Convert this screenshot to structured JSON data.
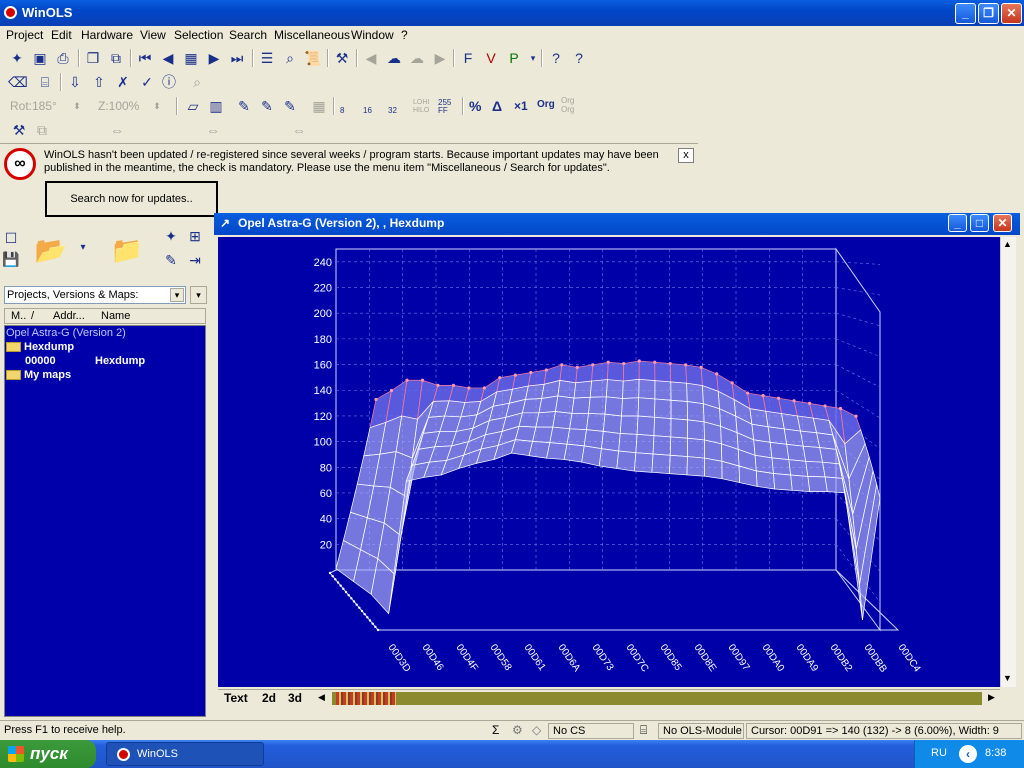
{
  "window": {
    "title": "WinOLS"
  },
  "menu": [
    "Project",
    "Edit",
    "Hardware",
    "View",
    "Selection",
    "Search",
    "Miscellaneous",
    "Window",
    "?"
  ],
  "toolbar": {
    "rot_label": "Rot:185°",
    "zoom_label": "Z:100%",
    "bits": [
      "8",
      "16",
      "32"
    ],
    "lohi_label": "LOHI HILO",
    "base_label": "255 FF",
    "percent_label": "%",
    "delta_label": "Δ",
    "times1_label": "×1",
    "org_label": "Org",
    "org2_label": "Org Org"
  },
  "notice": {
    "text": "WinOLS hasn't been updated / re-registered since several weeks / program starts. Because important updates may have been published in the meantime, the check is mandatory. Please use the menu item \"Miscellaneous / Search for updates\".",
    "button": "Search now for updates..",
    "close": "x"
  },
  "left_panel": {
    "dropdown": "Projects, Versions & Maps:",
    "columns": [
      "M..",
      "/",
      "Addr...",
      "Name"
    ],
    "project": "Opel Astra-G (Version 2)",
    "folders": [
      {
        "name": "Hexdump",
        "items": [
          {
            "addr": "00000",
            "name": "Hexdump"
          }
        ]
      },
      {
        "name": "My maps",
        "items": []
      }
    ]
  },
  "child_window": {
    "title": "Opel Astra-G (Version 2), , Hexdump",
    "tabs": [
      "Text",
      "2d",
      "3d"
    ]
  },
  "chart_data": {
    "type": "surface3d",
    "y_ticks": [
      "20",
      "40",
      "60",
      "80",
      "100",
      "120",
      "140",
      "160",
      "180",
      "200",
      "220",
      "240"
    ],
    "x_labels": [
      "00D3D",
      "00D46",
      "00D4F",
      "00D58",
      "00D61",
      "00D6A",
      "00D73",
      "00D7C",
      "00D85",
      "00D8E",
      "00D97",
      "00DA0",
      "00DA9",
      "00DB2",
      "00DBB",
      "00DC4"
    ],
    "front_row_values": [
      40,
      30,
      20,
      5,
      108,
      111,
      113,
      118,
      122,
      125,
      130,
      128,
      126,
      125,
      123,
      120,
      118,
      116,
      115,
      114,
      113,
      112,
      110,
      107,
      104,
      102,
      101,
      100,
      100,
      99,
      0,
      95
    ],
    "back_row_values": [
      125,
      132,
      140,
      140,
      136,
      136,
      134,
      134,
      142,
      144,
      146,
      148,
      152,
      150,
      152,
      154,
      153,
      155,
      154,
      153,
      152,
      150,
      145,
      138,
      130,
      128,
      126,
      124,
      122,
      120,
      118,
      112
    ],
    "ylim": [
      0,
      250
    ]
  },
  "status": {
    "help": "Press F1 to receive help.",
    "cs": "No CS",
    "module": "No OLS-Module",
    "cursor": "Cursor: 00D91 => 140 (132) -> 8 (6.00%), Width: 9"
  },
  "taskbar": {
    "start": "пуск",
    "task": "WinOLS",
    "lang": "RU",
    "time": "8:38"
  }
}
